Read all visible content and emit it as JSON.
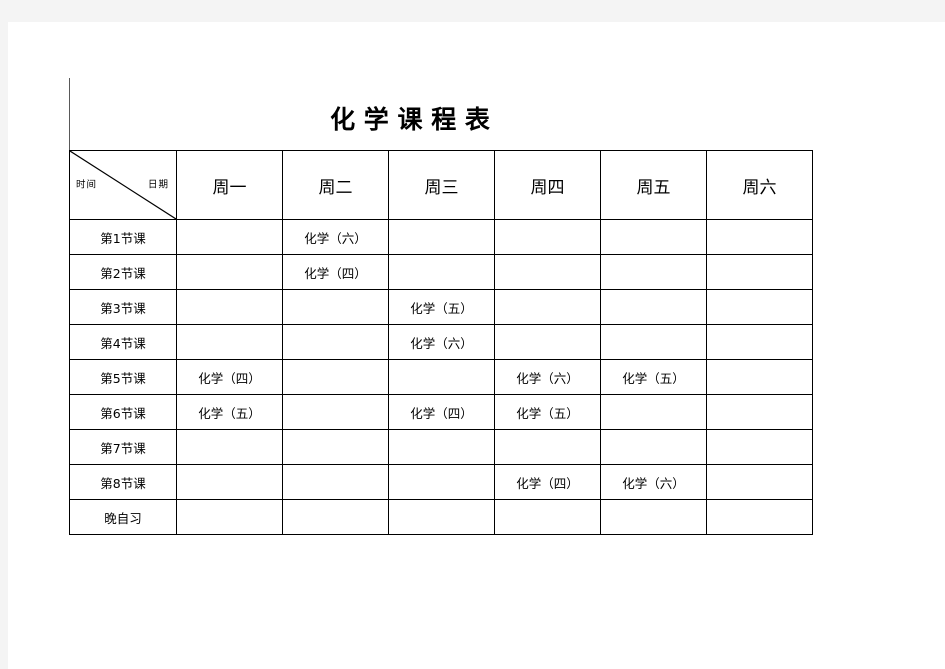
{
  "page": {
    "title": "化 学 课 程 表"
  },
  "table": {
    "corner": {
      "time_label": "时间",
      "date_label": "日期",
      "diagonal": "diagonal-divider"
    },
    "day_headers": [
      "周一",
      "周二",
      "周三",
      "周四",
      "周五",
      "周六"
    ],
    "rows": [
      {
        "label": "第1节课",
        "cells": [
          "",
          "化学（六）",
          "",
          "",
          "",
          ""
        ]
      },
      {
        "label": "第2节课",
        "cells": [
          "",
          "化学（四）",
          "",
          "",
          "",
          ""
        ]
      },
      {
        "label": "第3节课",
        "cells": [
          "",
          "",
          "化学（五）",
          "",
          "",
          ""
        ]
      },
      {
        "label": "第4节课",
        "cells": [
          "",
          "",
          "化学（六）",
          "",
          "",
          ""
        ]
      },
      {
        "label": "第5节课",
        "cells": [
          "化学（四）",
          "",
          "",
          "化学（六）",
          "化学（五）",
          ""
        ]
      },
      {
        "label": "第6节课",
        "cells": [
          "化学（五）",
          "",
          "化学（四）",
          "化学（五）",
          "",
          ""
        ]
      },
      {
        "label": "第7节课",
        "cells": [
          "",
          "",
          "",
          "",
          "",
          ""
        ]
      },
      {
        "label": "第8节课",
        "cells": [
          "",
          "",
          "",
          "化学（四）",
          "化学（六）",
          ""
        ]
      },
      {
        "label": "晚自习",
        "cells": [
          "",
          "",
          "",
          "",
          "",
          ""
        ]
      }
    ]
  },
  "colors": {
    "page_background": "#ffffff",
    "canvas_background": "#f4f4f4",
    "grid_line": "#000000",
    "text": "#000000"
  }
}
